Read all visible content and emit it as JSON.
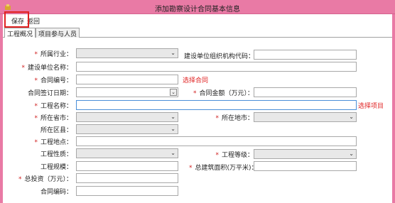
{
  "window": {
    "title": "添加勘察设计合同基本信息"
  },
  "toolbar": {
    "save_label": "保存",
    "back_label": "返回"
  },
  "tabs": [
    {
      "label": "工程概况",
      "active": true
    },
    {
      "label": "项目参与人员",
      "active": false
    }
  ],
  "fields": {
    "industry": "所属行业：",
    "org_code": "建设单位组织机构代码：",
    "unit_name": "建设单位名称：",
    "contract_no": "合同编号：",
    "select_contract": "选择合同",
    "sign_date": "合同签订日期：",
    "amount": "合同金额（万元）：",
    "project_name": "工程名称：",
    "select_project": "选择项目",
    "province": "所在省市：",
    "city": "所在地市：",
    "district": "所在区县：",
    "location": "工程地点：",
    "nature": "工程性质：",
    "grade": "工程等级：",
    "scale": "工程规模：",
    "area": "总建筑面积(万平米)：",
    "investment": "总投资（万元）：",
    "contract_code": "合同编码："
  },
  "colors": {
    "titlebar": "#e97aa5",
    "required": "#d02020",
    "highlight": "#e02020"
  }
}
